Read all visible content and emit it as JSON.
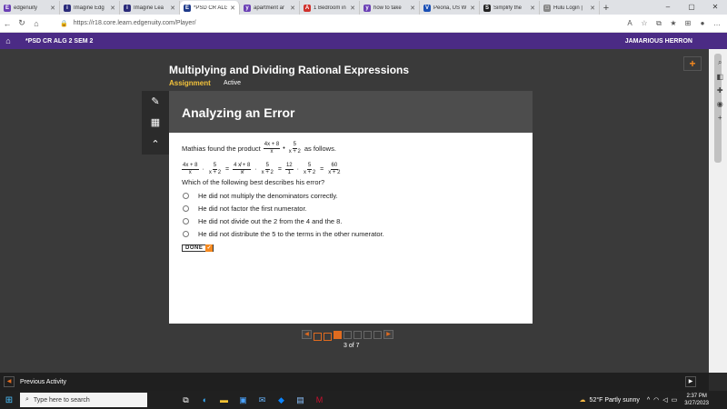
{
  "browser": {
    "tabs": [
      {
        "label": "edgenuity",
        "fav_color": "#6a3fb5",
        "fav_glyph": "E"
      },
      {
        "label": "Imagine Edg",
        "fav_color": "#2a2a7a",
        "fav_glyph": "i"
      },
      {
        "label": "Imagine Lea",
        "fav_color": "#2a2a7a",
        "fav_glyph": "i"
      },
      {
        "label": "*PSD CR ALG",
        "fav_color": "#1e3a8a",
        "fav_glyph": "E",
        "active": true
      },
      {
        "label": "apartment ar",
        "fav_color": "#6a3fb5",
        "fav_glyph": "y"
      },
      {
        "label": "1 Bedroom in",
        "fav_color": "#d0312d",
        "fav_glyph": "A"
      },
      {
        "label": "how to take",
        "fav_color": "#6a3fb5",
        "fav_glyph": "y"
      },
      {
        "label": "Peoria, US W",
        "fav_color": "#1a4fb5",
        "fav_glyph": "V"
      },
      {
        "label": "Simplify the",
        "fav_color": "#222222",
        "fav_glyph": "S"
      },
      {
        "label": "Hulu Login |",
        "fav_color": "#888888",
        "fav_glyph": "□"
      }
    ],
    "url": "https://r18.core.learn.edgenuity.com/Player/"
  },
  "header": {
    "course": "*PSD CR ALG 2 SEM 2",
    "user": "JAMARIOUS HERRON"
  },
  "lesson": {
    "title": "Multiplying and Dividing Rational Expressions",
    "type": "Assignment",
    "status": "Active"
  },
  "card": {
    "heading": "Analyzing an Error",
    "intro_pre": "Mathias found the product",
    "intro_post": "as follows.",
    "product": {
      "f1_num": "4x + 8",
      "f1_den": "x",
      "f2_num": "5",
      "f2_den": "x + 2"
    },
    "work": [
      {
        "num": "4x + 8",
        "den": "x"
      },
      {
        "op": "·"
      },
      {
        "num": "5",
        "den": "x + 2"
      },
      {
        "op": "="
      },
      {
        "num": "4 x̸ + 8",
        "den": "x̸"
      },
      {
        "op": "·"
      },
      {
        "num": "5",
        "den": "x + 2"
      },
      {
        "op": "="
      },
      {
        "num": "12",
        "den": "1"
      },
      {
        "op": "·"
      },
      {
        "num": "5",
        "den": "x + 2"
      },
      {
        "op": "="
      },
      {
        "num": "60",
        "den": "x + 2"
      }
    ],
    "question": "Which of the following best describes his error?",
    "choices": [
      "He did not multiply the denominators correctly.",
      "He did not factor the first numerator.",
      "He did not divide out the 2 from the 4 and the 8.",
      "He did not distribute the 5 to the terms in the other numerator."
    ],
    "done_label": "DONE"
  },
  "pager": {
    "count_text": "3 of 7",
    "total": 7,
    "current": 3
  },
  "footer": {
    "prev_label": "Previous Activity"
  },
  "taskbar": {
    "search_placeholder": "Type here to search",
    "weather": "52°F  Partly sunny",
    "time": "2:37 PM",
    "date": "3/27/2023"
  }
}
